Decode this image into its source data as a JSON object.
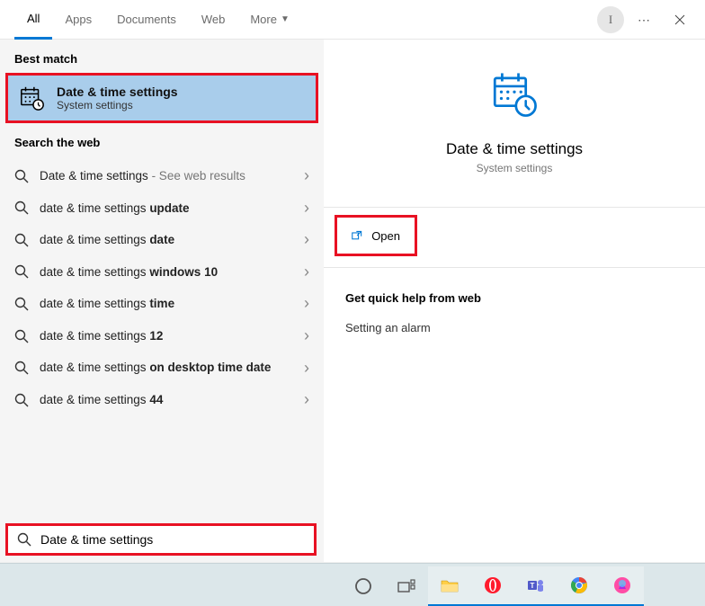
{
  "tabs": {
    "all": "All",
    "apps": "Apps",
    "documents": "Documents",
    "web": "Web",
    "more": "More"
  },
  "avatar_initial": "I",
  "sections": {
    "best_match": "Best match",
    "search_web": "Search the web",
    "quick_help": "Get quick help from web"
  },
  "best_match": {
    "title": "Date & time settings",
    "subtitle": "System settings"
  },
  "web_results": [
    {
      "base": "Date & time settings",
      "bold": "",
      "suffix": " - See web results"
    },
    {
      "base": "date & time settings ",
      "bold": "update",
      "suffix": ""
    },
    {
      "base": "date & time settings ",
      "bold": "date",
      "suffix": ""
    },
    {
      "base": "date & time settings ",
      "bold": "windows 10",
      "suffix": ""
    },
    {
      "base": "date & time settings ",
      "bold": "time",
      "suffix": ""
    },
    {
      "base": "date & time settings ",
      "bold": "12",
      "suffix": ""
    },
    {
      "base": "date & time settings ",
      "bold": "on desktop time date",
      "suffix": ""
    },
    {
      "base": "date & time settings ",
      "bold": "44",
      "suffix": ""
    }
  ],
  "detail": {
    "title": "Date & time settings",
    "subtitle": "System settings",
    "open": "Open"
  },
  "help_items": [
    "Setting an alarm"
  ],
  "search": {
    "value": "Date & time settings"
  },
  "colors": {
    "accent": "#0078d4",
    "highlight_border": "#e81123",
    "best_match_bg": "#a9cdeb"
  }
}
